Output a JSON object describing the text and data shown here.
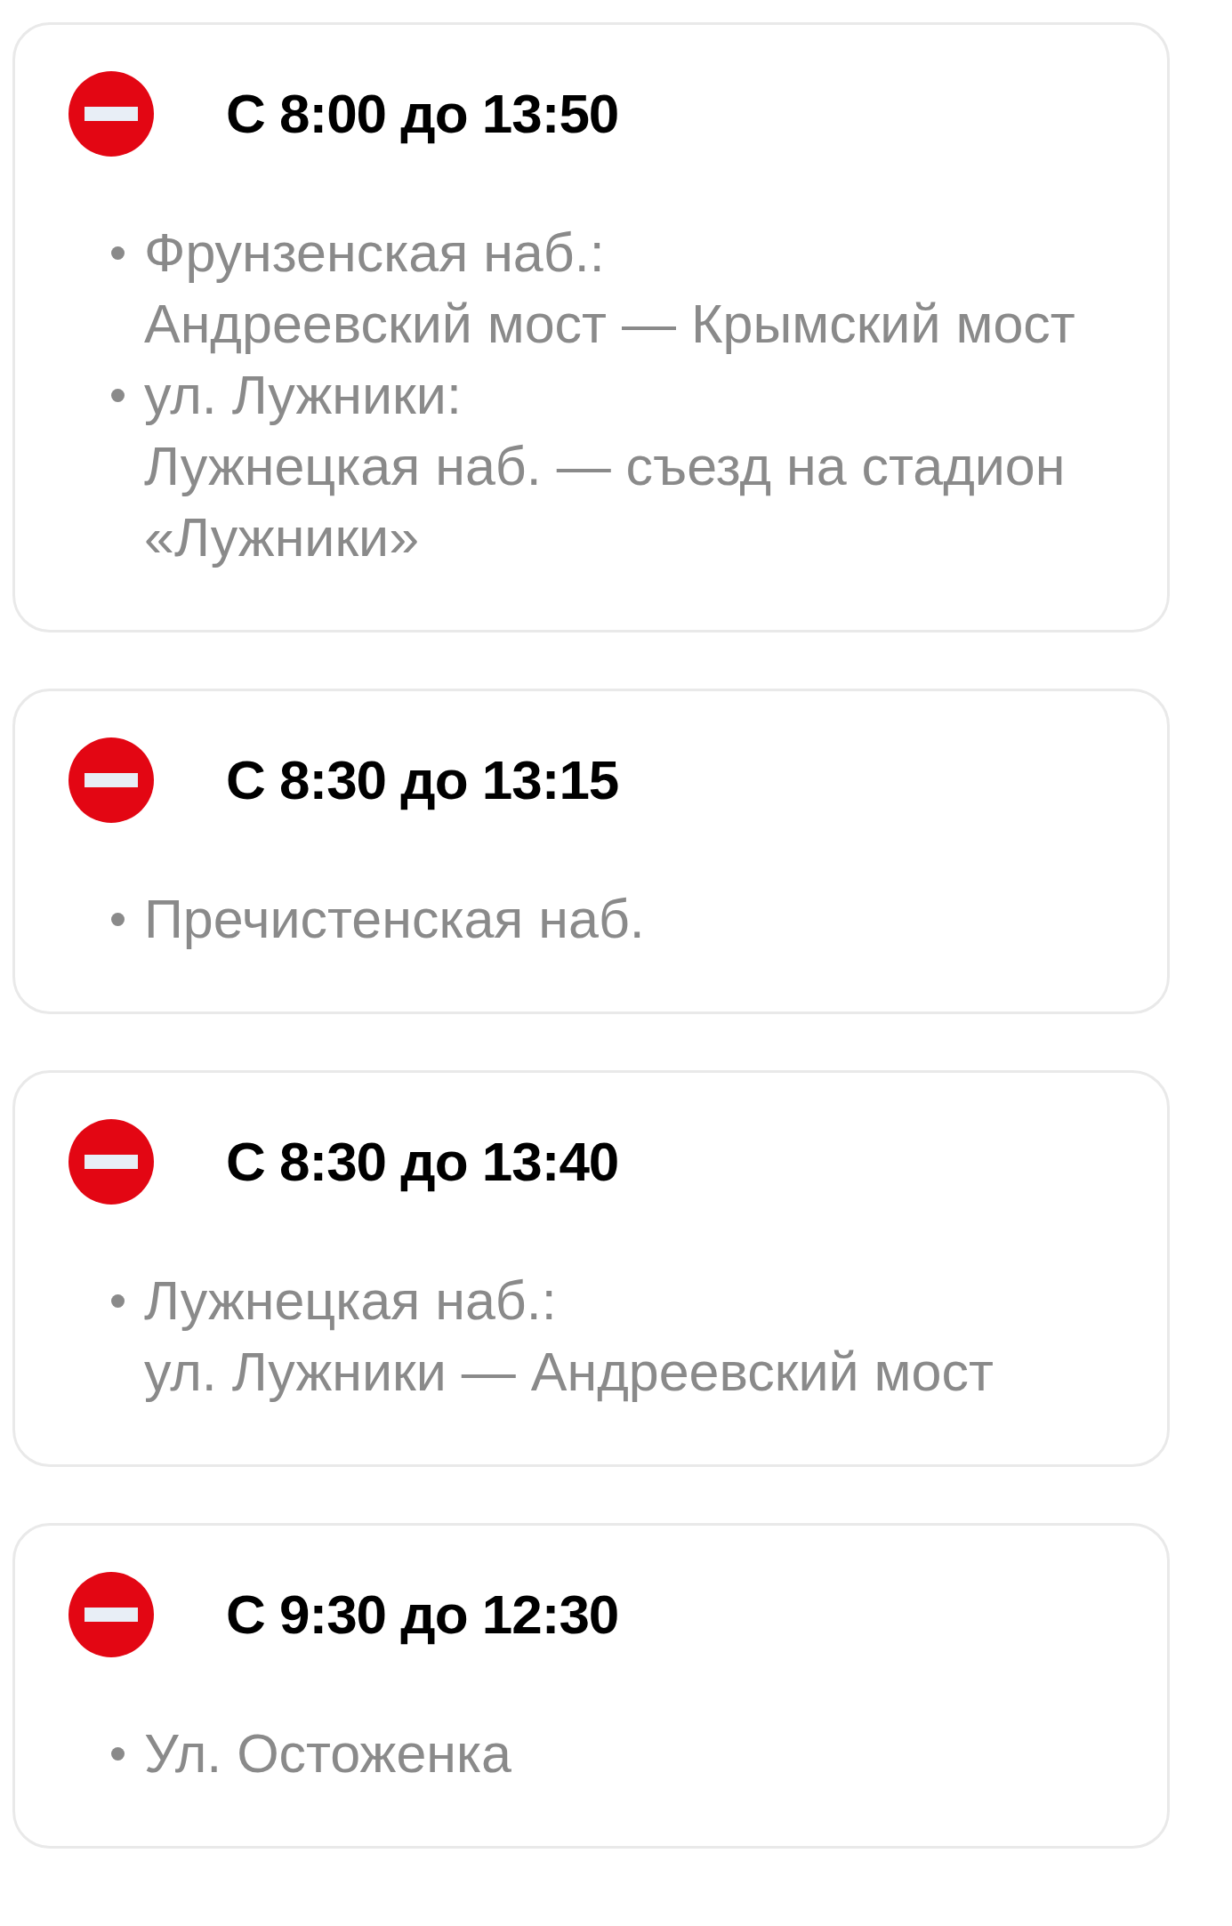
{
  "closures": [
    {
      "time": "С 8:00 до 13:50",
      "items": [
        {
          "street": "Фрунзенская наб.:",
          "segment": "Андреевский мост — Крымский мост"
        },
        {
          "street": "ул. Лужники:",
          "segment": "Лужнецкая наб. — съезд на стадион «Лужники»"
        }
      ]
    },
    {
      "time": "С 8:30 до 13:15",
      "items": [
        {
          "street": "Пречистенская наб."
        }
      ]
    },
    {
      "time": "С 8:30 до 13:40",
      "items": [
        {
          "street": "Лужнецкая наб.:",
          "segment": "ул. Лужники — Андреевский мост"
        }
      ]
    },
    {
      "time": "С 9:30 до 12:30",
      "items": [
        {
          "street": "Ул. Остоженка"
        }
      ]
    }
  ]
}
